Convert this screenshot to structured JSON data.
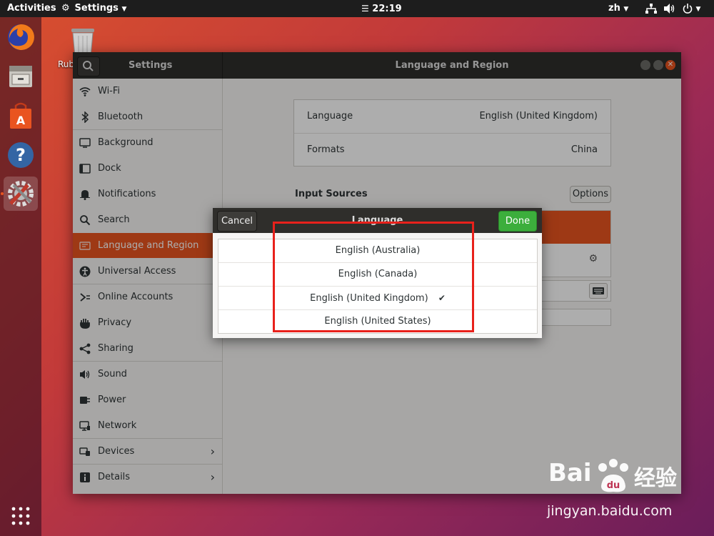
{
  "topbar": {
    "activities": "Activities",
    "app_menu": "Settings",
    "clock": "22:19",
    "input_method": "zh"
  },
  "desktop": {
    "trash_label": "Rub"
  },
  "window": {
    "sidebar_title": "Settings",
    "title": "Language and Region"
  },
  "sidebar": {
    "items": [
      {
        "label": "Wi-Fi"
      },
      {
        "label": "Bluetooth"
      },
      {
        "label": "Background"
      },
      {
        "label": "Dock"
      },
      {
        "label": "Notifications"
      },
      {
        "label": "Search"
      },
      {
        "label": "Language and Region"
      },
      {
        "label": "Universal Access"
      },
      {
        "label": "Online Accounts"
      },
      {
        "label": "Privacy"
      },
      {
        "label": "Sharing"
      },
      {
        "label": "Sound"
      },
      {
        "label": "Power"
      },
      {
        "label": "Network"
      },
      {
        "label": "Devices"
      },
      {
        "label": "Details"
      }
    ],
    "selected": "Language and Region"
  },
  "content": {
    "language_label": "Language",
    "language_value": "English (United Kingdom)",
    "formats_label": "Formats",
    "formats_value": "China",
    "input_sources_heading": "Input Sources",
    "options_button": "Options"
  },
  "dialog": {
    "title": "Language",
    "cancel": "Cancel",
    "done": "Done",
    "languages": [
      {
        "label": "English (Australia)",
        "selected": false
      },
      {
        "label": "English (Canada)",
        "selected": false
      },
      {
        "label": "English (United Kingdom)",
        "selected": true,
        "mark": "✔"
      },
      {
        "label": "English (United States)",
        "selected": false
      }
    ]
  },
  "watermark": {
    "brand": "Bai",
    "brand2": "经验",
    "url": "jingyan.baidu.com"
  },
  "colors": {
    "accent": "#e95420",
    "done_green": "#3cae3c",
    "highlight_red": "#e8211b"
  }
}
